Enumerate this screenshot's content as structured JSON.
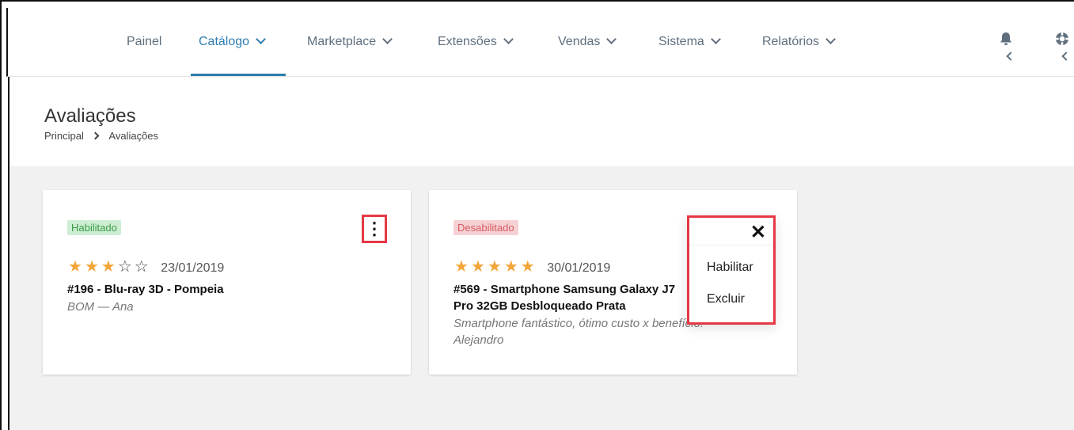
{
  "nav": {
    "items": [
      {
        "label": "Painel"
      },
      {
        "label": "Catálogo"
      },
      {
        "label": "Marketplace"
      },
      {
        "label": "Extensões"
      },
      {
        "label": "Vendas"
      },
      {
        "label": "Sistema"
      },
      {
        "label": "Relatórios"
      }
    ],
    "active_index": 1,
    "icons": [
      "bell-icon",
      "lifebuoy-icon"
    ]
  },
  "page": {
    "title": "Avaliações",
    "breadcrumb": [
      "Principal",
      "Avaliações"
    ]
  },
  "reviews": [
    {
      "status": "Habilitado",
      "rating": 3,
      "max_rating": 5,
      "date": "23/01/2019",
      "product": "#196 - Blu-ray 3D - Pompeia",
      "comment": "BOM — Ana"
    },
    {
      "status": "Desabilitado",
      "rating": 5,
      "max_rating": 5,
      "date": "30/01/2019",
      "product": "#569 - Smartphone Samsung Galaxy J7 Pro 32GB Desbloqueado Prata",
      "comment": "Smartphone fantástico, ótimo custo x benefício! — Alejandro"
    }
  ],
  "context_menu": {
    "items": [
      {
        "label": "Habilitar"
      },
      {
        "label": "Excluir"
      }
    ]
  },
  "colors": {
    "accent": "#2e7db0",
    "star": "#f2a63a",
    "enabled_bg": "#cdeed3",
    "disabled_bg": "#f6d1d4",
    "highlight": "#e53945"
  }
}
